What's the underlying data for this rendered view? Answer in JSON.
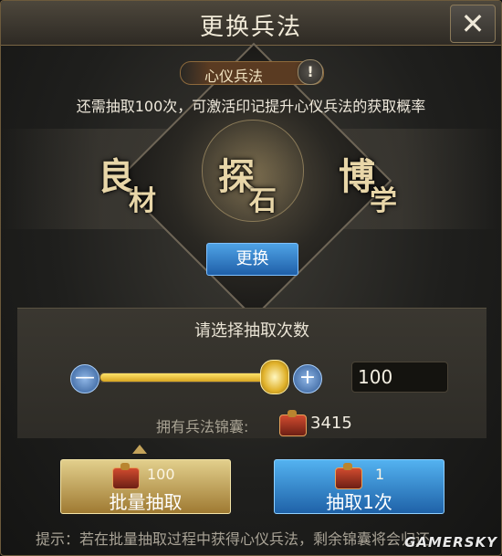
{
  "header": {
    "title": "更换兵法",
    "close_symbol": "✕"
  },
  "school": {
    "name": "心仪兵法",
    "info_symbol": "!"
  },
  "hint_top": "还需抽取100次，可激活印记提升心仪兵法的获取概率",
  "glyphs": [
    {
      "top": "良",
      "bottom": "材"
    },
    {
      "top": "探",
      "bottom": "石"
    },
    {
      "top": "博",
      "bottom": "学"
    }
  ],
  "swap_button": "更换",
  "selector": {
    "title": "请选择抽取次数",
    "minus_symbol": "—",
    "plus_symbol": "+",
    "quantity": "100",
    "slider_fraction": 1.0,
    "owned_label": "拥有兵法锦囊:",
    "owned_count": "3415"
  },
  "actions": {
    "batch": {
      "cost": "100",
      "label": "批量抽取"
    },
    "single": {
      "cost": "1",
      "label": "抽取1次"
    }
  },
  "bottom_hint": "提示：若在批量抽取过程中获得心仪兵法，剩余锦囊将会归还",
  "watermark": "GAMERSKY",
  "colors": {
    "accent_gold": "#d8a521",
    "accent_blue": "#1f62a8"
  },
  "icons": {
    "close": "close-icon",
    "pouch": "silk-pouch-icon",
    "info": "info-icon"
  }
}
